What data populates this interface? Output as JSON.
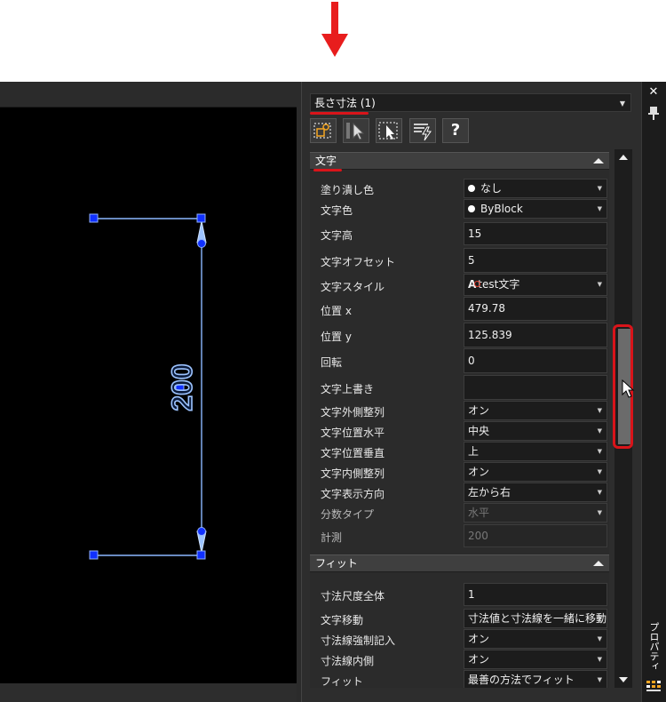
{
  "panel": {
    "title_select": "長さ寸法 (1)",
    "sections": {
      "text": {
        "header": "文字",
        "rows": [
          {
            "label": "塗り潰し色",
            "value": "なし"
          },
          {
            "label": "文字色",
            "value": "ByBlock"
          },
          {
            "label": "文字高",
            "value": "15"
          },
          {
            "label": "文字オフセット",
            "value": "5"
          },
          {
            "label": "文字スタイル",
            "value": "test文字"
          },
          {
            "label": "位置 x",
            "value": "479.78"
          },
          {
            "label": "位置 y",
            "value": "125.839"
          },
          {
            "label": "回転",
            "value": "0"
          },
          {
            "label": "文字上書き",
            "value": ""
          },
          {
            "label": "文字外側整列",
            "value": "オン"
          },
          {
            "label": "文字位置水平",
            "value": "中央"
          },
          {
            "label": "文字位置垂直",
            "value": "上"
          },
          {
            "label": "文字内側整列",
            "value": "オン"
          },
          {
            "label": "文字表示方向",
            "value": "左から右"
          },
          {
            "label": "分数タイプ",
            "value": "水平"
          },
          {
            "label": "計測",
            "value": "200"
          }
        ]
      },
      "fit": {
        "header": "フィット",
        "rows": [
          {
            "label": "寸法尺度全体",
            "value": "1"
          },
          {
            "label": "文字移動",
            "value": "寸法値と寸法線を一緒に移動"
          },
          {
            "label": "寸法線強制記入",
            "value": "オン"
          },
          {
            "label": "寸法線内側",
            "value": "オン"
          },
          {
            "label": "フィット",
            "value": "最善の方法でフィット"
          }
        ]
      }
    },
    "toolbar": {
      "help_label": "?"
    }
  },
  "drawing": {
    "dimension_text": "200"
  },
  "dock": {
    "close_label": "✕",
    "tab_label": "プロパティ"
  },
  "colors": {
    "highlight": "#d9141a",
    "dimension_line": "#7fb3ff",
    "grip": "#1030ff"
  }
}
